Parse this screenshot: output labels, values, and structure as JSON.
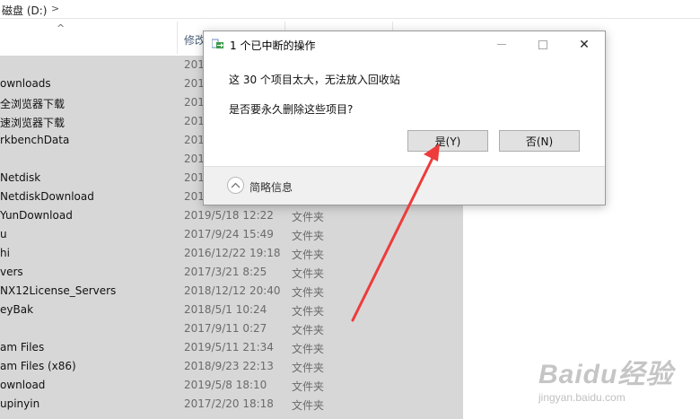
{
  "address_bar": {
    "path": "磁盘 (D:)",
    "separator": ">"
  },
  "columns": {
    "sort_indicator": "^",
    "date_modified": "修改"
  },
  "files": [
    {
      "name": "",
      "date": "201",
      "type": ""
    },
    {
      "name": "ownloads",
      "date": "201",
      "type": ""
    },
    {
      "name": "全浏览器下载",
      "date": "201",
      "type": ""
    },
    {
      "name": "速浏览器下载",
      "date": "201",
      "type": ""
    },
    {
      "name": "rkbenchData",
      "date": "201",
      "type": ""
    },
    {
      "name": "",
      "date": "201",
      "type": ""
    },
    {
      "name": "Netdisk",
      "date": "201",
      "type": ""
    },
    {
      "name": "NetdiskDownload",
      "date": "201",
      "type": ""
    },
    {
      "name": "YunDownload",
      "date": "2019/5/18 12:22",
      "type": "文件夹"
    },
    {
      "name": "u",
      "date": "2017/9/24 15:49",
      "type": "文件夹"
    },
    {
      "name": "hi",
      "date": "2016/12/22 19:18",
      "type": "文件夹"
    },
    {
      "name": "vers",
      "date": "2017/3/21 8:25",
      "type": "文件夹"
    },
    {
      "name": "NX12License_Servers",
      "date": "2018/12/12 20:40",
      "type": "文件夹"
    },
    {
      "name": "eyBak",
      "date": "2018/5/1 10:24",
      "type": "文件夹"
    },
    {
      "name": "",
      "date": "2017/9/11 0:27",
      "type": "文件夹"
    },
    {
      "name": "am Files",
      "date": "2019/5/11 21:34",
      "type": "文件夹"
    },
    {
      "name": "am Files (x86)",
      "date": "2018/9/23 22:13",
      "type": "文件夹"
    },
    {
      "name": "ownload",
      "date": "2019/5/8 18:10",
      "type": "文件夹"
    },
    {
      "name": "upinyin",
      "date": "2017/2/20 18:18",
      "type": "文件夹"
    },
    {
      "name": "",
      "date": "",
      "type": ""
    }
  ],
  "dialog": {
    "title": "1 个已中断的操作",
    "message": "这 30 个项目太大，无法放入回收站",
    "question": "是否要永久删除这些项目?",
    "yes_label": "是(Y)",
    "no_label": "否(N)",
    "details_label": "简略信息",
    "close_glyph": "✕"
  },
  "watermark": {
    "brand": "Baidu经验",
    "url": "jingyan.baidu.com"
  },
  "colors": {
    "selection": "#d7d7d7",
    "annotation_arrow": "#ee3b3b",
    "dialog_footer": "#f0f0f0"
  }
}
